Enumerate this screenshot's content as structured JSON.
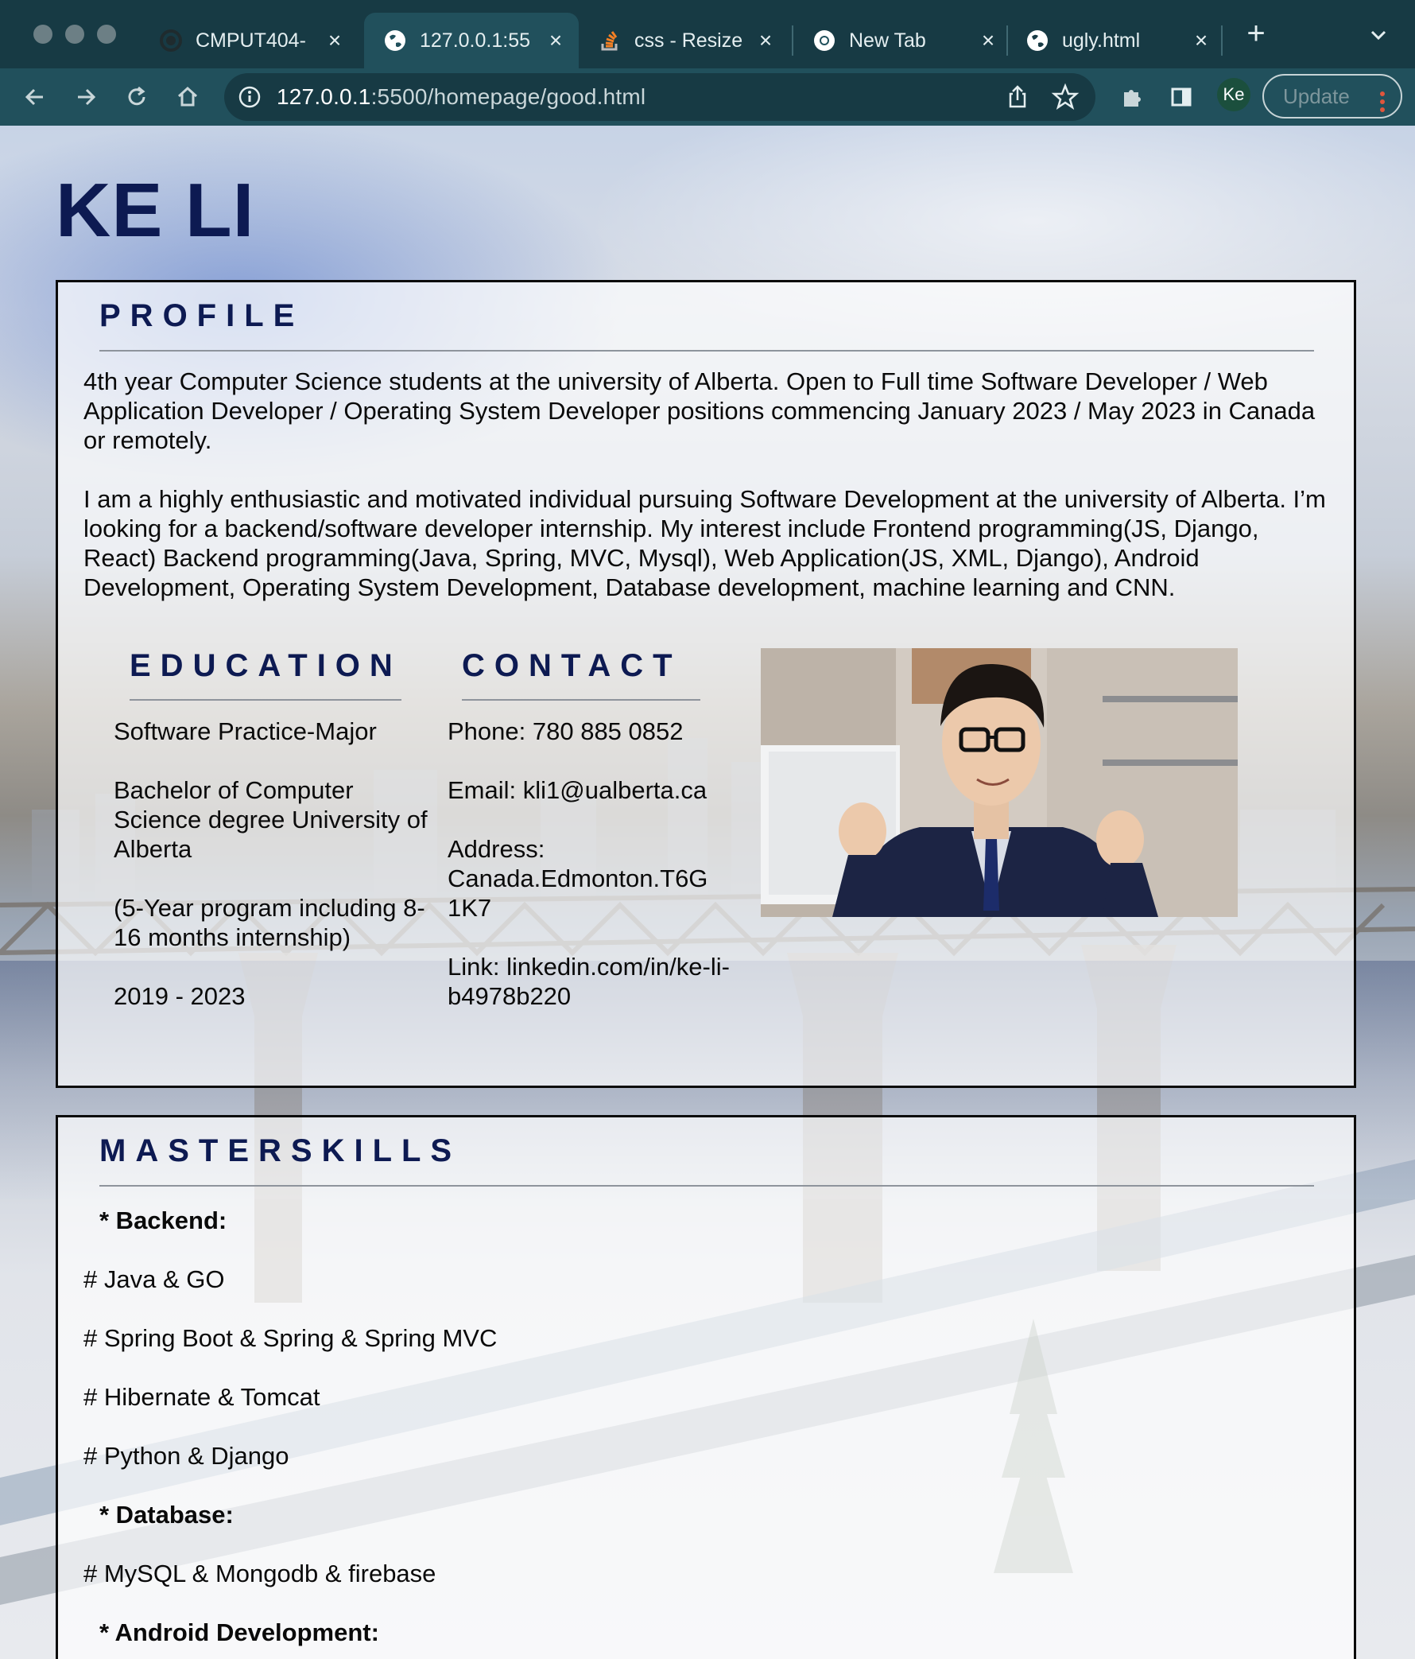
{
  "browser": {
    "tabs": [
      {
        "title": "CMPUT404-",
        "icon": "github-icon"
      },
      {
        "title": "127.0.0.1:55",
        "icon": "globe-icon",
        "active": true
      },
      {
        "title": "css - Resize",
        "icon": "stackoverflow-icon"
      },
      {
        "title": "New Tab",
        "icon": "chrome-icon"
      },
      {
        "title": "ugly.html",
        "icon": "globe-icon"
      }
    ],
    "url_host": "127.0.0.1",
    "url_path": ":5500/homepage/good.html",
    "profile_initials": "Ke",
    "update_label": "Update"
  },
  "page": {
    "name": "KE LI",
    "profile": {
      "title": "PROFILE",
      "para1": "4th year Computer Science students at the university of Alberta. Open to Full time Software Developer / Web Application Developer / Operating System Developer positions commencing January 2023 / May 2023 in Canada or remotely.",
      "para2": "I am a highly enthusiastic and motivated individual pursuing Software Development at the university of Alberta. I’m looking for a backend/software developer internship. My interest include Frontend programming(JS, Django, React) Backend programming(Java, Spring, MVC, Mysql), Web Application(JS, XML, Django), Android Development, Operating System Development, Database development, machine learning and CNN."
    },
    "education": {
      "title": "EDUCATION",
      "items": [
        "Software Practice-Major",
        "Bachelor of Computer Science degree University of Alberta",
        "(5-Year program including 8-16 months internship)",
        "2019 - 2023"
      ]
    },
    "contact": {
      "title": "CONTACT",
      "items": [
        "Phone: 780 885 0852",
        "Email: kli1@ualberta.ca",
        "Address: Canada.Edmonton.T6G 1K7",
        "Link: linkedin.com/in/ke-li-b4978b220"
      ]
    },
    "skills": {
      "title": "MASTERSKILLS",
      "lines": [
        {
          "text": "* Backend:",
          "head": true
        },
        {
          "text": "# Java & GO",
          "head": false
        },
        {
          "text": "# Spring Boot & Spring & Spring MVC",
          "head": false
        },
        {
          "text": "# Hibernate & Tomcat",
          "head": false
        },
        {
          "text": "# Python & Django",
          "head": false
        },
        {
          "text": "* Database:",
          "head": true
        },
        {
          "text": "# MySQL & Mongodb & firebase",
          "head": false
        },
        {
          "text": "* Android Development:",
          "head": true
        }
      ]
    }
  },
  "colors": {
    "chrome_dark": "#173a44",
    "chrome_toolbar": "#21505c",
    "name_color": "#0d1a52"
  }
}
